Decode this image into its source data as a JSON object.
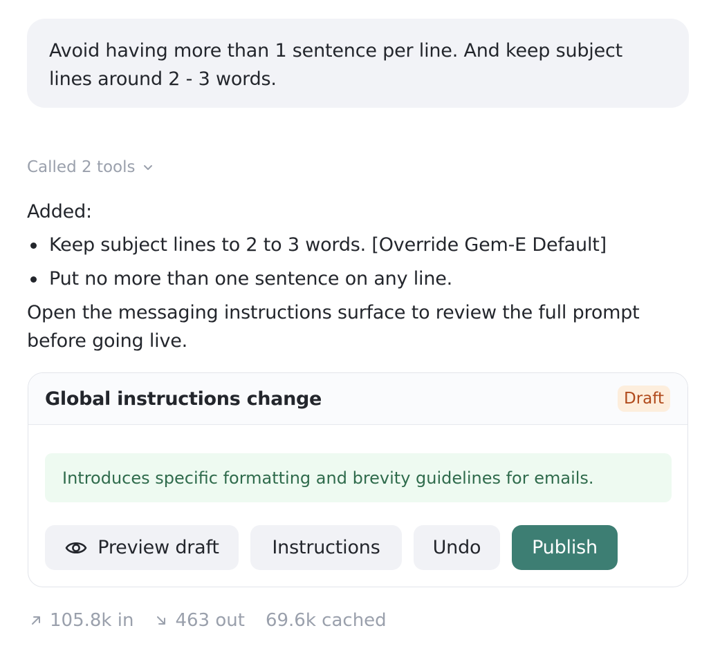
{
  "user_message": {
    "text": "Avoid having more than 1 sentence per line. And keep subject lines around 2 - 3 words."
  },
  "tools": {
    "label": "Called 2 tools",
    "icon": "chevron-down-icon"
  },
  "reply": {
    "intro": "Added:",
    "items": [
      "Keep subject lines to 2 to 3 words. [Override Gem-E Default]",
      "Put no more than one sentence on any line."
    ],
    "note": "Open the messaging instructions surface to review the full prompt before going live."
  },
  "card": {
    "title": "Global instructions change",
    "badge": "Draft",
    "summary": "Introduces specific formatting and brevity guidelines for emails.",
    "buttons": {
      "preview": "Preview draft",
      "instructions": "Instructions",
      "undo": "Undo",
      "publish": "Publish"
    }
  },
  "stats": {
    "input": "105.8k in",
    "output": "463 out",
    "cached": "69.6k cached"
  },
  "colors": {
    "bubble_bg": "#f2f3f7",
    "badge_bg": "#fdeedd",
    "badge_text": "#b04a1c",
    "summary_bg": "#eefaf1",
    "summary_text": "#2f6b4c",
    "publish_bg": "#3d7e73"
  }
}
